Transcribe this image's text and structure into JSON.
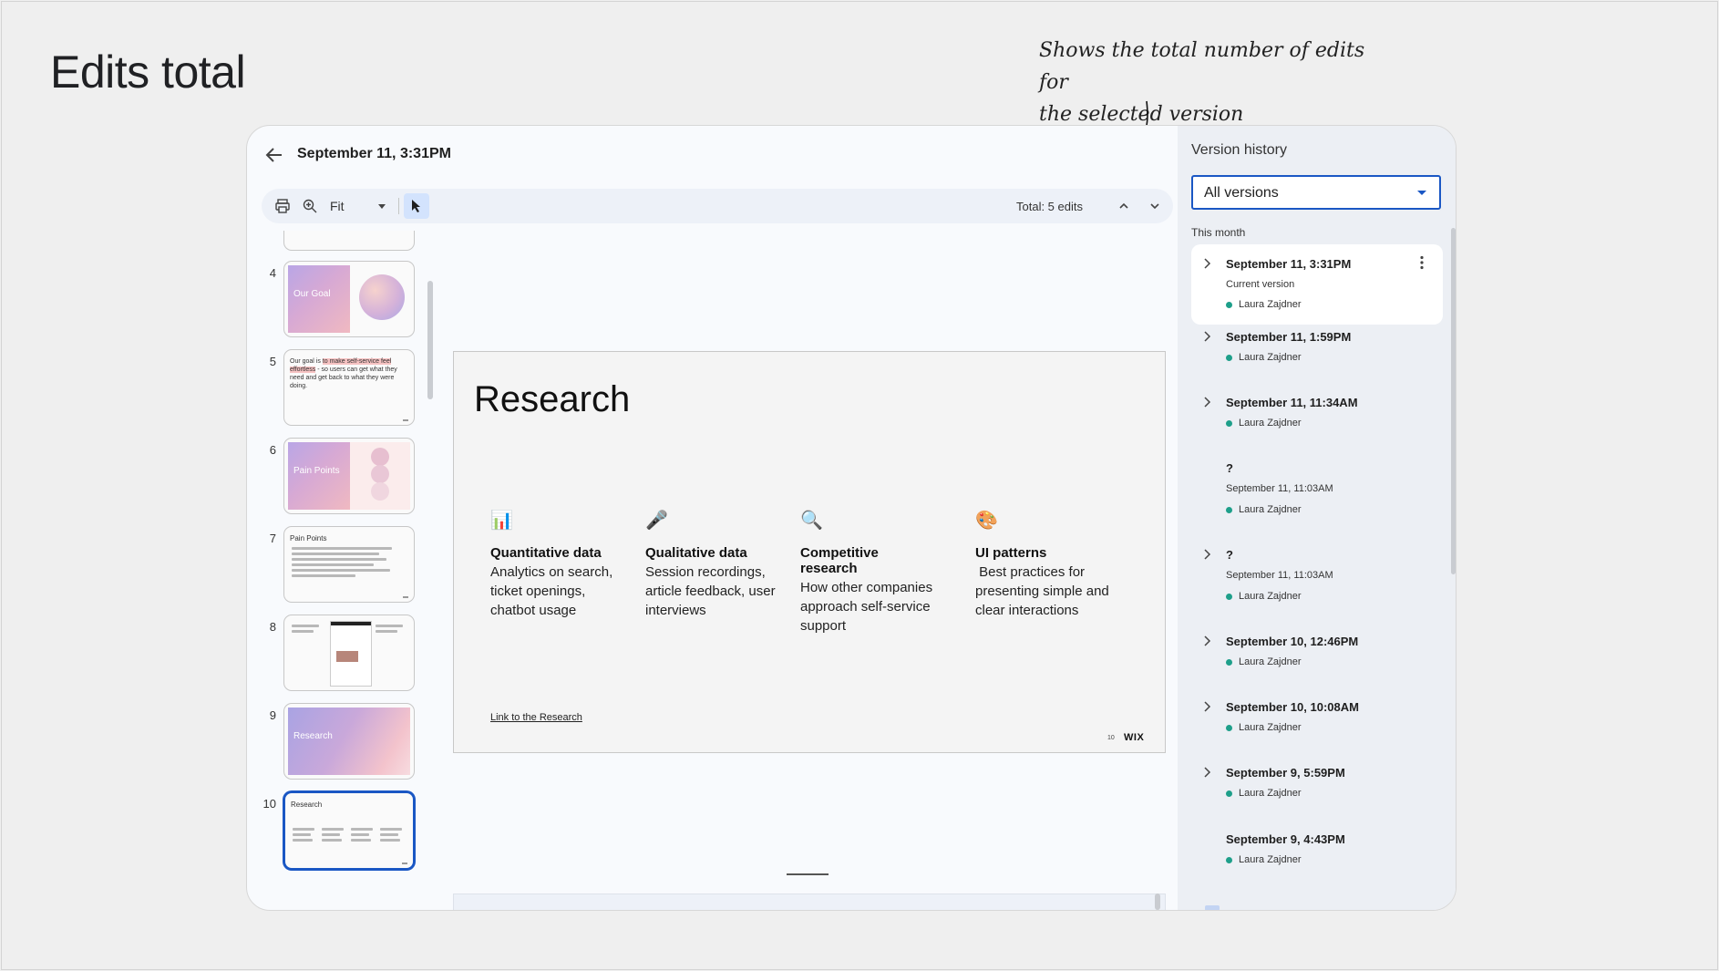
{
  "page": {
    "title": "Edits total",
    "annotation_line1": "Shows the total number of edits for",
    "annotation_line2": "the selected version"
  },
  "header": {
    "back_icon": "arrow-left-icon",
    "doc_title": "September 11, 3:31PM"
  },
  "toolbar": {
    "print_icon": "print-icon",
    "zoom_icon": "zoom-in-icon",
    "zoom_value": "Fit",
    "select_icon": "cursor-icon",
    "total_label": "Total: 5 edits",
    "prev_icon": "chevron-up-icon",
    "next_icon": "chevron-down-icon"
  },
  "thumbnails": {
    "items": [
      {
        "num": "4",
        "label": "Our Goal"
      },
      {
        "num": "5",
        "text_pre": "Our goal is ",
        "text_hl": "to make self-service feel effortless",
        "text_post": " - so users can get what they need and get back to what they were doing."
      },
      {
        "num": "6",
        "label": "Pain Points"
      },
      {
        "num": "7",
        "label": "Pain Points"
      },
      {
        "num": "8"
      },
      {
        "num": "9",
        "label": "Research"
      },
      {
        "num": "10",
        "label": "Research"
      }
    ]
  },
  "slide": {
    "title": "Research",
    "columns": [
      {
        "icon": "📊",
        "heading": "Quantitative data",
        "body": "Analytics on search, ticket openings, chatbot usage"
      },
      {
        "icon": "🎤",
        "heading": "Qualitative data",
        "body": "Session recordings, article feedback, user interviews"
      },
      {
        "icon": "🔍",
        "heading": "Competitive research",
        "body": "How other companies approach self-service support"
      },
      {
        "icon": "🎨",
        "heading": "UI patterns",
        "body": " Best practices for presenting simple and clear interactions"
      }
    ],
    "link": "Link to the Research",
    "page_num": "10",
    "logo": "WIX"
  },
  "version_history": {
    "title": "Version history",
    "filter_value": "All versions",
    "group_label": "This month",
    "items": [
      {
        "title": "September 11, 3:31PM",
        "subtitle": "Current version",
        "author": "Laura Zajdner"
      },
      {
        "title": "September 11, 1:59PM",
        "author": "Laura Zajdner"
      },
      {
        "title": "September 11, 11:34AM",
        "author": "Laura Zajdner"
      },
      {
        "title": "?",
        "subtitle": "September 11, 11:03AM",
        "author": "Laura Zajdner"
      },
      {
        "title": "?",
        "subtitle": "September 11, 11:03AM",
        "author": "Laura Zajdner"
      },
      {
        "title": "September 10, 12:46PM",
        "author": "Laura Zajdner"
      },
      {
        "title": "September 10, 10:08AM",
        "author": "Laura Zajdner"
      },
      {
        "title": "September 9, 5:59PM",
        "author": "Laura Zajdner"
      },
      {
        "title": "September 9, 4:43PM",
        "author": "Laura Zajdner"
      }
    ]
  },
  "colors": {
    "accent": "#1a57c4",
    "author_dot": "#1e9f8a"
  }
}
